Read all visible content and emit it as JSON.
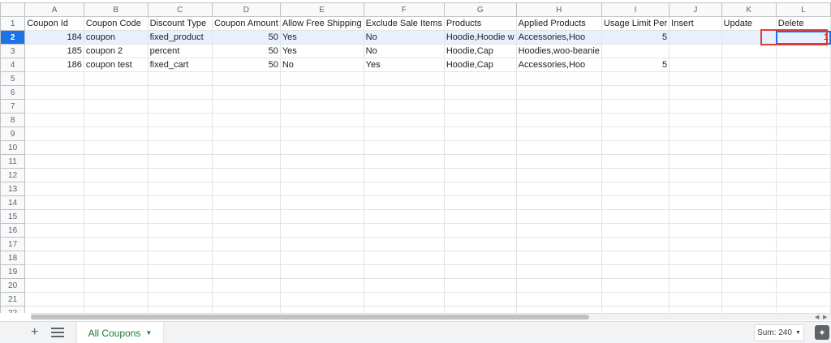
{
  "columns": [
    "A",
    "B",
    "C",
    "D",
    "E",
    "F",
    "G",
    "H",
    "I",
    "J",
    "K",
    "L"
  ],
  "header_row": [
    "Coupon Id",
    "Coupon Code",
    "Discount Type",
    "Coupon Amount",
    "Allow Free Shipping",
    "Exclude Sale Items",
    "Products",
    "Applied Products",
    "Usage Limit Per",
    "Insert",
    "Update",
    "Delete"
  ],
  "rows": [
    [
      "184",
      "coupon",
      "fixed_product",
      "50",
      "Yes",
      "No",
      "Hoodie,Hoodie w",
      "Accessories,Hoo",
      "5",
      "",
      "",
      "1"
    ],
    [
      "185",
      "coupon 2",
      "percent",
      "50",
      "Yes",
      "No",
      "Hoodie,Cap",
      "Hoodies,woo-beanie",
      "",
      "",
      "",
      ""
    ],
    [
      "186",
      "coupon test",
      "fixed_cart",
      "50",
      "No",
      "Yes",
      "Hoodie,Cap",
      "Accessories,Hoo",
      "5",
      "",
      "",
      ""
    ]
  ],
  "row_numbers": [
    "1",
    "2",
    "3",
    "4",
    "5",
    "6",
    "7",
    "8",
    "9",
    "10",
    "11",
    "12",
    "13",
    "14",
    "15",
    "16",
    "17",
    "18",
    "19",
    "20",
    "21",
    "22"
  ],
  "bottom_bar": {
    "add_sheet_icon": "+",
    "sheet_tab_label": "All Coupons",
    "sum_label": "Sum: 240"
  },
  "colors": {
    "selection_blue": "#1a73e8",
    "highlight_red": "#e53935",
    "tab_green": "#188038"
  }
}
